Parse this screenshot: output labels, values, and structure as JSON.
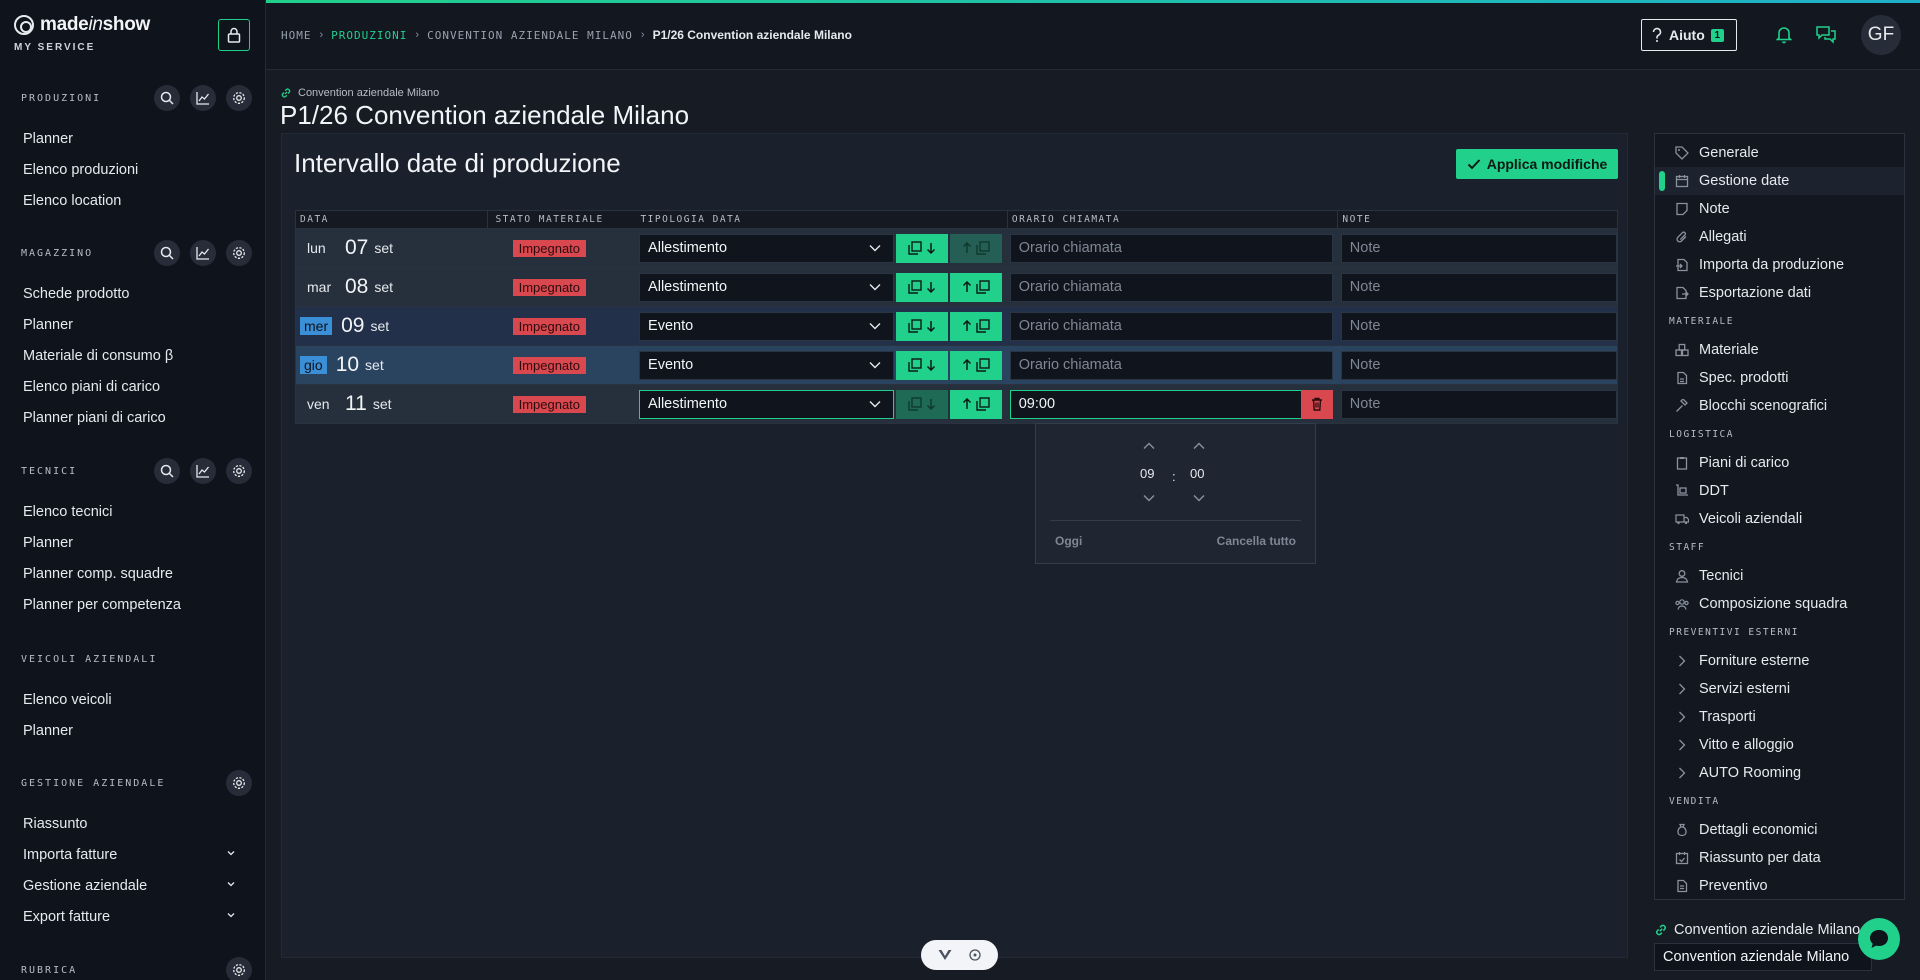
{
  "brand": {
    "name_main": "made",
    "name_italic": "in",
    "name_end": "show",
    "subtitle": "MY SERVICE"
  },
  "colors": {
    "accent": "#21d08b",
    "danger": "#d9474f",
    "highlight": "#3a8fd6"
  },
  "sidebar": {
    "sections": [
      {
        "label": "PRODUZIONI",
        "items": [
          "Planner",
          "Elenco produzioni",
          "Elenco location"
        ]
      },
      {
        "label": "MAGAZZINO",
        "items": [
          "Schede prodotto",
          "Planner",
          "Materiale di consumo β",
          "Elenco piani di carico",
          "Planner piani di carico"
        ]
      },
      {
        "label": "TECNICI",
        "items": [
          "Elenco tecnici",
          "Planner",
          "Planner comp. squadre",
          "Planner per competenza"
        ]
      },
      {
        "label": "VEICOLI AZIENDALI",
        "items": [
          "Elenco veicoli",
          "Planner"
        ]
      },
      {
        "label": "GESTIONE AZIENDALE",
        "items": [
          "Riassunto",
          "Importa fatture",
          "Gestione aziendale",
          "Export fatture"
        ]
      },
      {
        "label": "RUBRICA",
        "items": []
      }
    ]
  },
  "topbar": {
    "breadcrumbs": [
      "HOME",
      "PRODUZIONI",
      "CONVENTION AZIENDALE MILANO"
    ],
    "breadcrumb_current": "P1/26 Convention aziendale Milano",
    "help_label": "Aiuto",
    "help_count": "1",
    "avatar_initials": "GF"
  },
  "page": {
    "parent_link": "Convention aziendale Milano",
    "title": "P1/26 Convention aziendale Milano"
  },
  "panel": {
    "title": "Intervallo date di produzione",
    "apply_label": "Applica modifiche",
    "columns": [
      "DATA",
      "STATO MATERIALE",
      "TIPOLOGIA DATA",
      "ORARIO CHIAMATA",
      "NOTE"
    ],
    "rows": [
      {
        "day": "lun",
        "num": "07",
        "month": "set",
        "status": "Impegnato",
        "type": "Allestimento",
        "time": "",
        "note": ""
      },
      {
        "day": "mar",
        "num": "08",
        "month": "set",
        "status": "Impegnato",
        "type": "Allestimento",
        "time": "",
        "note": ""
      },
      {
        "day": "mer",
        "num": "09",
        "month": "set",
        "status": "Impegnato",
        "type": "Evento",
        "time": "",
        "note": ""
      },
      {
        "day": "gio",
        "num": "10",
        "month": "set",
        "status": "Impegnato",
        "type": "Evento",
        "time": "",
        "note": ""
      },
      {
        "day": "ven",
        "num": "11",
        "month": "set",
        "status": "Impegnato",
        "type": "Allestimento",
        "time": "09:00",
        "note": ""
      }
    ],
    "time_placeholder": "Orario chiamata",
    "note_placeholder": "Note",
    "picker": {
      "hours": "09",
      "minutes": "00",
      "separator": ":",
      "today_label": "Oggi",
      "clear_label": "Cancella tutto"
    }
  },
  "right_nav": {
    "top_items": [
      "Generale",
      "Gestione date",
      "Note",
      "Allegati",
      "Importa da produzione",
      "Esportazione dati"
    ],
    "active_item": "Gestione date",
    "groups": [
      {
        "label": "MATERIALE",
        "items": [
          "Materiale",
          "Spec. prodotti",
          "Blocchi scenografici"
        ]
      },
      {
        "label": "LOGISTICA",
        "items": [
          "Piani di carico",
          "DDT",
          "Veicoli aziendali"
        ]
      },
      {
        "label": "STAFF",
        "items": [
          "Tecnici",
          "Composizione squadra"
        ]
      },
      {
        "label": "PREVENTIVI ESTERNI",
        "items": [
          "Forniture esterne",
          "Servizi esterni",
          "Trasporti",
          "Vitto e alloggio",
          "AUTO Rooming"
        ]
      },
      {
        "label": "VENDITA",
        "items": [
          "Dettagli economici",
          "Riassunto per data",
          "Preventivo"
        ]
      }
    ],
    "bottom_link": "Convention aziendale Milano",
    "bottom_select": "Convention aziendale Milano"
  }
}
